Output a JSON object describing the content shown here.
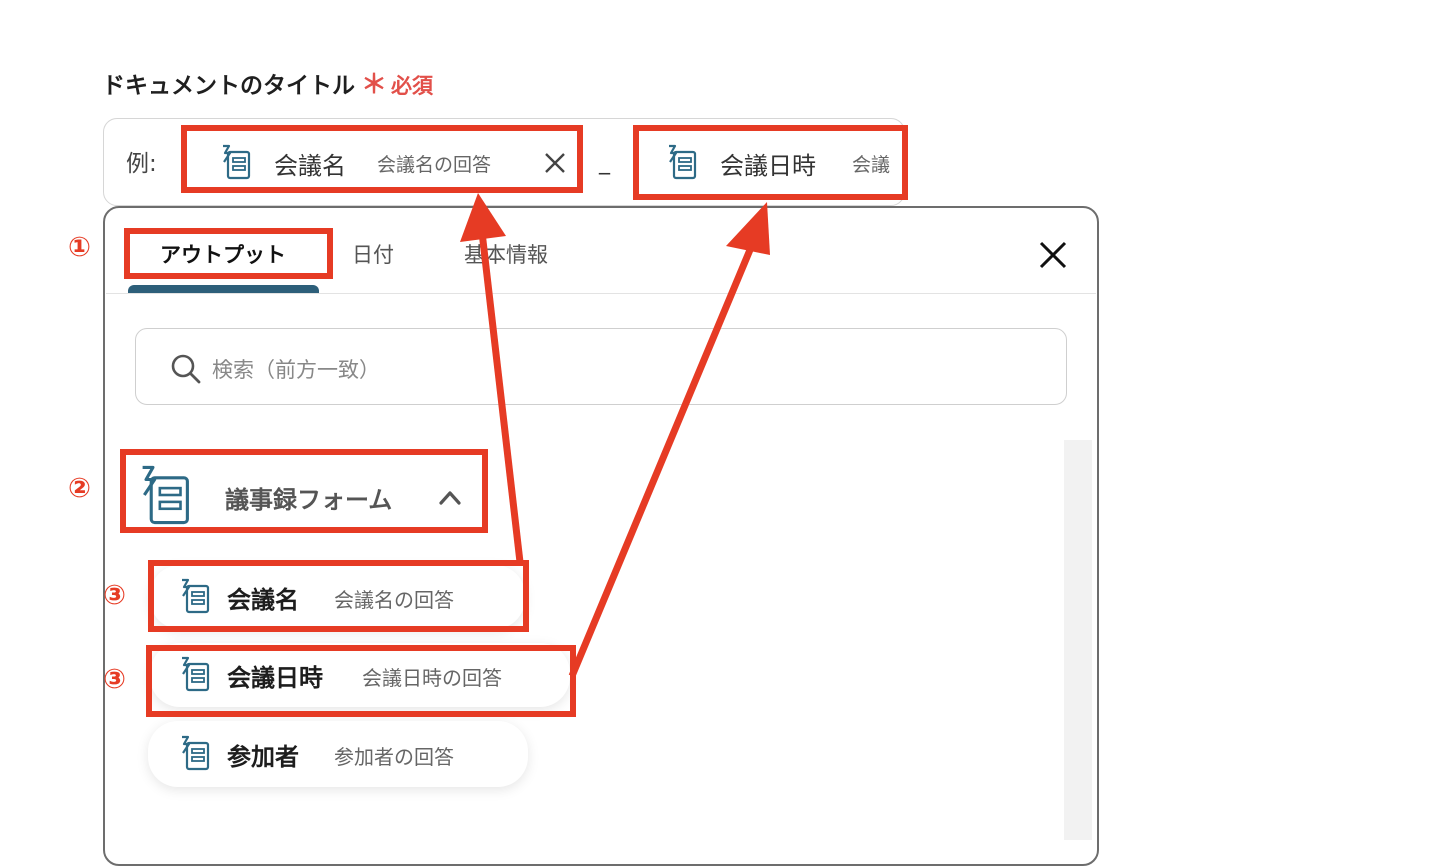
{
  "field": {
    "label": "ドキュメントのタイトル",
    "required_mark": "＊",
    "required_text": "必須"
  },
  "title_input": {
    "prefix": "例:",
    "chip1": {
      "main": "会議名",
      "sub": "会議名の回答"
    },
    "separator": "_",
    "chip2": {
      "main": "会議日時",
      "sub": "会議"
    }
  },
  "panel": {
    "tabs": [
      {
        "label": "アウトプット",
        "active": true
      },
      {
        "label": "日付",
        "active": false
      },
      {
        "label": "基本情報",
        "active": false
      }
    ],
    "search_placeholder": "検索（前方一致）",
    "group": {
      "name": "議事録フォーム"
    },
    "items": [
      {
        "main": "会議名",
        "sub": "会議名の回答"
      },
      {
        "main": "会議日時",
        "sub": "会議日時の回答"
      },
      {
        "main": "参加者",
        "sub": "参加者の回答"
      }
    ]
  },
  "annotations": {
    "step1": "①",
    "step2": "②",
    "step3a": "③",
    "step3b": "③"
  },
  "colors": {
    "highlight": "#e63b24",
    "accent": "#2d5f7a",
    "required": "#e2504a"
  },
  "icons": {
    "form_icon": "form-document-icon",
    "search": "search-icon",
    "close": "close-icon",
    "chevron": "chevron-up-icon"
  }
}
